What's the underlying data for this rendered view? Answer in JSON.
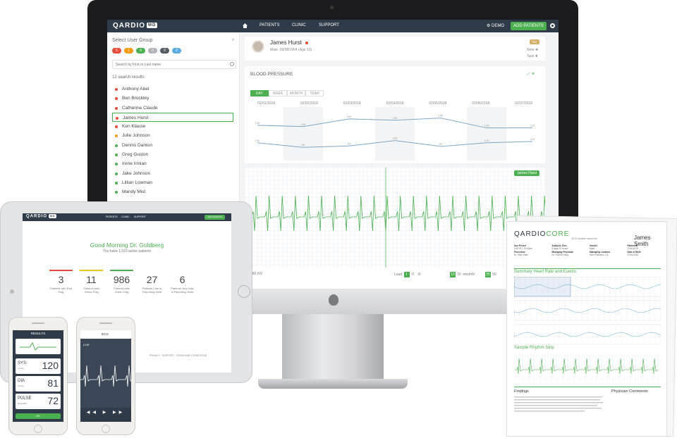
{
  "desktop": {
    "logo": "QARDIO",
    "logo_badge": "MD",
    "nav": [
      "PATIENTS",
      "CLINIC",
      "SUPPORT"
    ],
    "demo_label": "DEMO",
    "add_button": "ADD PATIENTS",
    "left_panel": {
      "title": "Select User Group",
      "chips": [
        {
          "label": "5",
          "color": "#e74c3c"
        },
        {
          "label": "1",
          "color": "#f39c12"
        },
        {
          "label": "6",
          "color": "#4caf50"
        },
        {
          "label": "0",
          "color": "#b0b3b7"
        },
        {
          "label": "0",
          "color": "#555b63"
        },
        {
          "label": "2",
          "color": "#5dade2"
        }
      ],
      "search_placeholder": "Search by First or Last name",
      "results": "12 search results",
      "patients": [
        {
          "name": "Anthony Abel",
          "color": "#e74c3c"
        },
        {
          "name": "Ben Brockley",
          "color": "#e74c3c"
        },
        {
          "name": "Catherine Claude",
          "color": "#e74c3c"
        },
        {
          "name": "James Hurst",
          "color": "#e74c3c"
        },
        {
          "name": "Ken Klause",
          "color": "#e74c3c"
        },
        {
          "name": "Julie Johnson",
          "color": "#f39c12"
        },
        {
          "name": "Dennis Danton",
          "color": "#4caf50"
        },
        {
          "name": "Greg Guston",
          "color": "#4caf50"
        },
        {
          "name": "Irene Irmian",
          "color": "#4caf50"
        },
        {
          "name": "Jake Johnson",
          "color": "#4caf50"
        },
        {
          "name": "Lillian Lowman",
          "color": "#4caf50"
        },
        {
          "name": "Mandy Mist",
          "color": "#4caf50"
        }
      ],
      "selected_index": 3
    },
    "patient": {
      "name": "James Hurst",
      "meta": "Male, 09/08/1964 (Age 53)",
      "badge": "PID",
      "note_label": "Note",
      "task_label": "Task"
    },
    "blood_pressure": {
      "title": "BLOOD PRESSURE",
      "tabs": [
        "DAY",
        "WEEK",
        "MONTH",
        "YEAR"
      ],
      "active_tab": "DAY",
      "dates": [
        "02/01/2018",
        "02/02/2018",
        "02/03/2018",
        "02/04/2018",
        "02/05/2018",
        "02/06/2018",
        "02/07/2018"
      ],
      "systolic": [
        139,
        136,
        153,
        150,
        155,
        133,
        133
      ],
      "diastolic": [
        100,
        90,
        93,
        105,
        92,
        100,
        103
      ]
    },
    "ecg": {
      "label": "James Hurst",
      "scale": "280 mV",
      "lead_label": "Lead",
      "leads": [
        "I",
        "II",
        "III"
      ],
      "active_lead": "I",
      "speeds": [
        "10",
        "20"
      ],
      "active_speed": "10",
      "speed_unit": "mm/mV",
      "gains": [
        "25",
        "50"
      ],
      "active_gain": "25"
    }
  },
  "tablet": {
    "greeting": "Good Morning Dr. Goldberg",
    "subtitle": "You have 1,033 active patients",
    "stats": [
      {
        "value": "3",
        "label": "Patients with Red Flag",
        "color": "#e74c3c"
      },
      {
        "value": "11",
        "label": "Patients with Yellow Flag",
        "color": "#f1c40f"
      },
      {
        "value": "986",
        "label": "Patients with Green Flag",
        "color": "#4caf50"
      },
      {
        "value": "27",
        "label": "Patients Late in Reporting Data",
        "color": "#ffffff"
      },
      {
        "value": "6",
        "label": "Patients Very Late in Reporting Data",
        "color": "#ffffff"
      }
    ],
    "footer": [
      "PRIVACY",
      "SUPPORT",
      "TERMS AND CONDITIONS"
    ]
  },
  "phone_bp": {
    "header": "RESULTS",
    "vitals": [
      {
        "label": "SYS",
        "sub": "mmHg",
        "value": "120"
      },
      {
        "label": "DIA",
        "sub": "mmHg",
        "value": "81"
      },
      {
        "label": "PULSE",
        "sub": "Beats/Min",
        "value": "72"
      }
    ],
    "ok_button": "OK"
  },
  "phone_ecg": {
    "header": "ECG",
    "live": "LIVE"
  },
  "report": {
    "logo_a": "QARDIO",
    "logo_b": "CORE",
    "for": "ECG monitor report for:",
    "name": "James Smith",
    "fields": [
      {
        "k": "Use Period",
        "v": "10/01/17 10:42pm"
      },
      {
        "k": "Analysis Time",
        "v": "6 days 10 hours"
      },
      {
        "k": "Gender",
        "v": "Male"
      },
      {
        "k": "Patient ID",
        "v": "2246-4619"
      },
      {
        "k": "Procedure",
        "v": "Dr. Gray Stein"
      },
      {
        "k": "Managing Physician",
        "v": "Dr. Francis Yang"
      },
      {
        "k": "Managing Location",
        "v": "San Francisco, CA"
      },
      {
        "k": "Date of Birth",
        "v": "01/01/1951"
      }
    ],
    "summary_title": "Summary Heart Rate and Events",
    "strip_title": "Sample Rhythm Strip",
    "findings_title": "Findings",
    "comments_title": "Physician Comments"
  }
}
